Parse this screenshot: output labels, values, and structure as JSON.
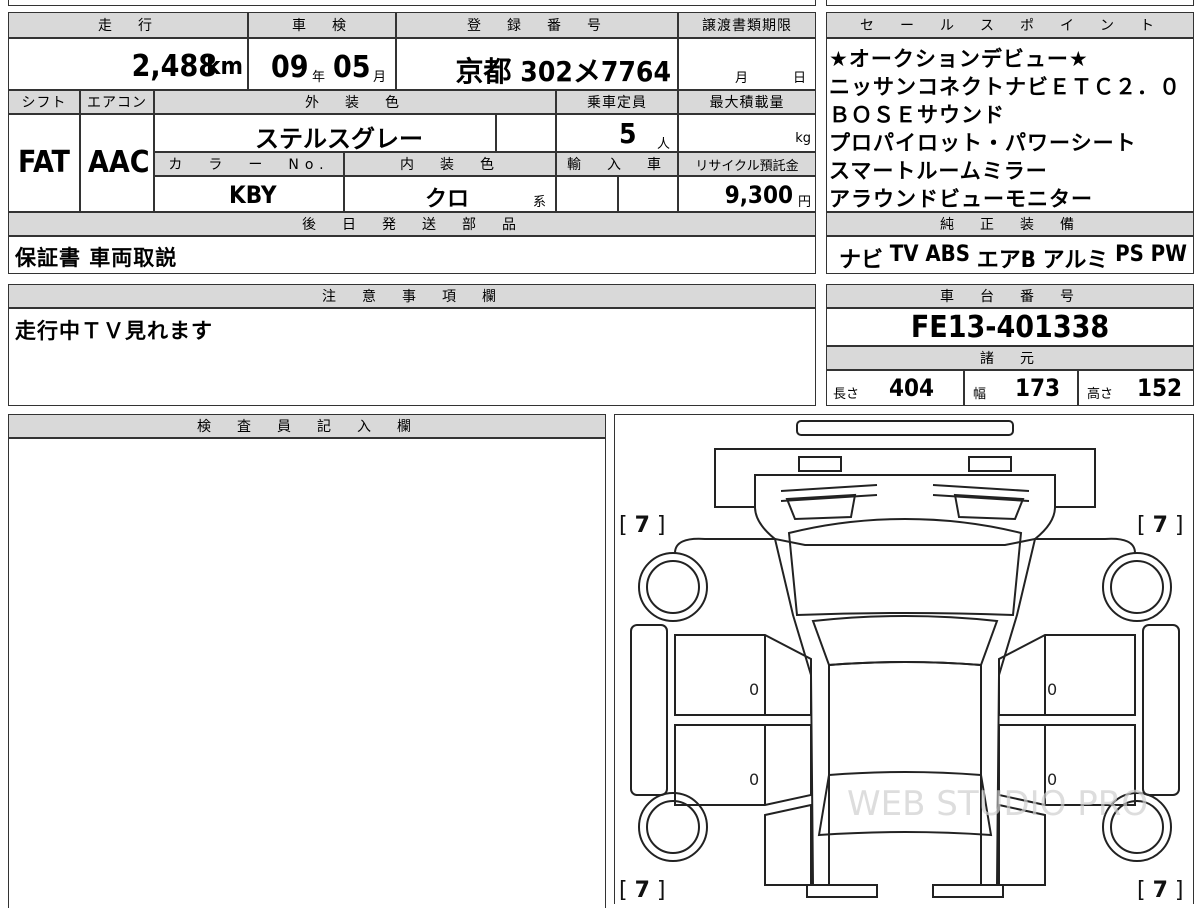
{
  "top_table": {
    "headers": {
      "mileage": "走　行",
      "inspection": "車　検",
      "registration": "登　録　番　号",
      "transfer_deadline": "譲渡書類期限",
      "shift": "シフト",
      "aircon": "エアコン",
      "exterior_color": "外　装　色",
      "capacity": "乗車定員",
      "max_load": "最大積載量",
      "color_no": "カ　ラ　ー　No.",
      "interior_color": "内　装　色",
      "import": "輸　入　車",
      "recycle_fee": "リサイクル預託金",
      "later_parts": "後　日　発　送　部　品"
    },
    "mileage_value": "2,488",
    "mileage_unit": "km",
    "inspection_year": "09",
    "year_unit": "年",
    "inspection_month": "05",
    "month_unit": "月",
    "registration_number": "京都 302メ7764",
    "transfer_month_unit": "月",
    "transfer_day_unit": "日",
    "shift_value": "FAT",
    "aircon_value": "AAC",
    "exterior_color_value": "ステルスグレー",
    "capacity_value": "5",
    "capacity_unit": "人",
    "max_load_unit": "kg",
    "color_no_value": "KBY",
    "interior_color_value": "クロ",
    "interior_color_suffix": "系",
    "recycle_fee_value": "9,300",
    "recycle_fee_unit": "円",
    "later_parts_value": "保証書 車両取説"
  },
  "sales_points": {
    "header": "セ　ー　ル　ス　ポ　イ　ン　ト",
    "lines": [
      "★オークションデビュー★",
      "ニッサンコネクトナビＥＴＣ２．０",
      "ＢＯＳＥサウンド",
      "プロパイロット・パワーシート",
      "スマートルームミラー",
      "アラウンドビューモニター"
    ]
  },
  "standard_equipment": {
    "header": "純　正　装　備",
    "items": [
      "ナビ",
      "TV",
      "ABS",
      "エアB",
      "アルミ",
      "PS",
      "PW"
    ]
  },
  "notes": {
    "header": "注　意　事　項　欄",
    "text": "走行中ＴＶ見れます"
  },
  "chassis": {
    "header": "車　台　番　号",
    "number": "FE13-401338"
  },
  "specs": {
    "header": "諸　元",
    "length_label": "長さ",
    "length": "404",
    "width_label": "幅",
    "width": "173",
    "height_label": "高さ",
    "height": "152"
  },
  "inspector": {
    "header": "検　査　員　記　入　欄"
  },
  "diagram": {
    "tire_tread_front_left": "7",
    "tire_tread_front_right": "7",
    "tire_tread_rear_left": "7",
    "tire_tread_rear_right": "7",
    "panel_marks": [
      "0",
      "0",
      "0",
      "0"
    ],
    "watermark": "WEB STUDIO PRO"
  }
}
